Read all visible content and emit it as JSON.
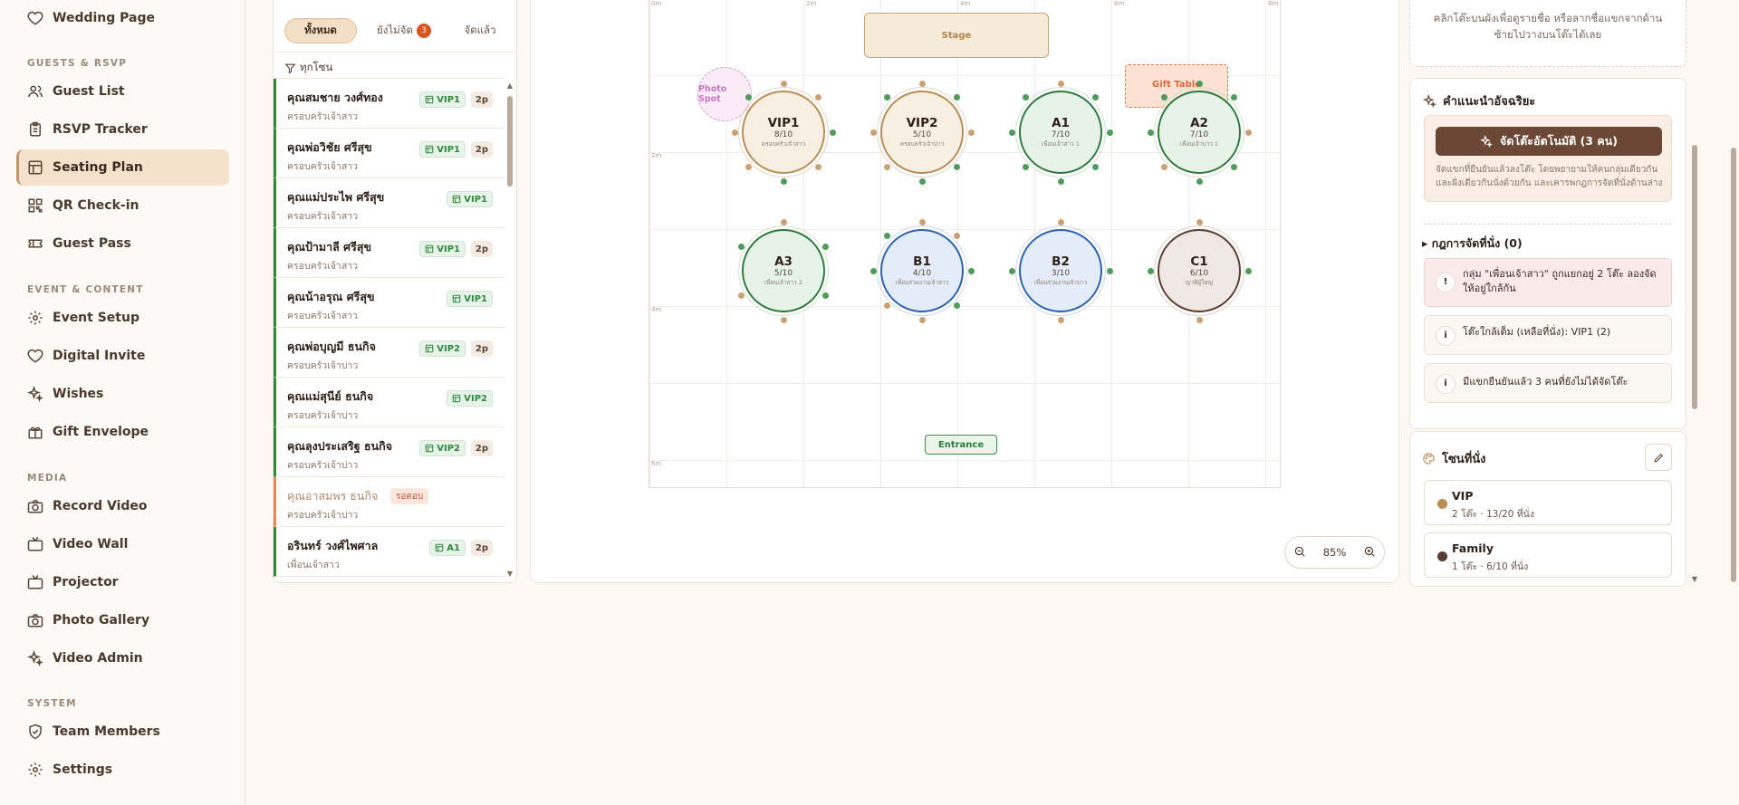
{
  "sidebar": {
    "items_top": [
      {
        "label": "Wedding Page",
        "icon": "heart-icon"
      }
    ],
    "sections": [
      {
        "title": "GUESTS & RSVP",
        "items": [
          {
            "label": "Guest List",
            "icon": "users-icon"
          },
          {
            "label": "RSVP Tracker",
            "icon": "clipboard-icon"
          },
          {
            "label": "Seating Plan",
            "icon": "layout-icon",
            "active": true
          },
          {
            "label": "QR Check-in",
            "icon": "qr-icon"
          },
          {
            "label": "Guest Pass",
            "icon": "ticket-icon"
          }
        ]
      },
      {
        "title": "EVENT & CONTENT",
        "items": [
          {
            "label": "Event Setup",
            "icon": "gear-icon"
          },
          {
            "label": "Digital Invite",
            "icon": "heart-icon"
          },
          {
            "label": "Wishes",
            "icon": "sparkle-icon"
          },
          {
            "label": "Gift Envelope",
            "icon": "gift-icon"
          }
        ]
      },
      {
        "title": "MEDIA",
        "items": [
          {
            "label": "Record Video",
            "icon": "camera-icon"
          },
          {
            "label": "Video Wall",
            "icon": "tv-icon"
          },
          {
            "label": "Projector",
            "icon": "tv-icon"
          },
          {
            "label": "Photo Gallery",
            "icon": "camera-icon"
          },
          {
            "label": "Video Admin",
            "icon": "sparkle-icon"
          }
        ]
      },
      {
        "title": "SYSTEM",
        "items": [
          {
            "label": "Team Members",
            "icon": "shield-icon"
          },
          {
            "label": "Settings",
            "icon": "gear-icon"
          }
        ]
      }
    ]
  },
  "guest_panel": {
    "tabs": [
      {
        "label": "ทั้งหมด",
        "active": true
      },
      {
        "label": "ยังไม่จัด",
        "badge": "3"
      },
      {
        "label": "จัดแล้ว"
      }
    ],
    "filter_label": "ทุกโซน",
    "guests": [
      {
        "name": "คุณสมชาย วงศ์ทอง",
        "group": "ครอบครัวเจ้าสาว",
        "table": "VIP1",
        "count": "2p"
      },
      {
        "name": "คุณพ่อวิชัย ศรีสุข",
        "group": "ครอบครัวเจ้าสาว",
        "table": "VIP1",
        "count": "2p"
      },
      {
        "name": "คุณแม่ประไพ ศรีสุข",
        "group": "ครอบครัวเจ้าสาว",
        "table": "VIP1",
        "count": ""
      },
      {
        "name": "คุณป้ามาลี ศรีสุข",
        "group": "ครอบครัวเจ้าสาว",
        "table": "VIP1",
        "count": "2p"
      },
      {
        "name": "คุณน้าอรุณ ศรีสุข",
        "group": "ครอบครัวเจ้าสาว",
        "table": "VIP1",
        "count": ""
      },
      {
        "name": "คุณพ่อบุญมี ธนกิจ",
        "group": "ครอบครัวเจ้าบ่าว",
        "table": "VIP2",
        "count": "2p"
      },
      {
        "name": "คุณแม่สุนีย์ ธนกิจ",
        "group": "ครอบครัวเจ้าบ่าว",
        "table": "VIP2",
        "count": ""
      },
      {
        "name": "คุณลุงประเสริฐ ธนกิจ",
        "group": "ครอบครัวเจ้าบ่าว",
        "table": "VIP2",
        "count": "2p"
      },
      {
        "name": "คุณอาสมพร ธนกิจ",
        "group": "ครอบครัวเจ้าบ่าว",
        "pending": "รอตอบ"
      },
      {
        "name": "อรินทร์ วงศ์ไพศาล",
        "group": "เพื่อนเจ้าสาว",
        "table": "A1",
        "count": "2p"
      }
    ]
  },
  "canvas": {
    "rulers": [
      "0m",
      "2m",
      "4m",
      "6m",
      "8m",
      "2m",
      "4m",
      "6m"
    ],
    "zones": {
      "stage": "Stage",
      "gift": "Gift Table",
      "photo": "Photo Spot",
      "entrance": "Entrance"
    },
    "tables": [
      {
        "name": "VIP1",
        "count": "8/10",
        "group": "ครอบครัวเจ้าสาว",
        "style": "vip"
      },
      {
        "name": "VIP2",
        "count": "5/10",
        "group": "ครอบครัวเจ้าบ่าว",
        "style": "vip"
      },
      {
        "name": "A1",
        "count": "7/10",
        "group": "เพื่อนเจ้าสาว 1",
        "style": "grn"
      },
      {
        "name": "A2",
        "count": "7/10",
        "group": "เพื่อนเจ้าบ่าว 1",
        "style": "grn"
      },
      {
        "name": "A3",
        "count": "5/10",
        "group": "เพื่อนเจ้าสาว 2",
        "style": "grn"
      },
      {
        "name": "B1",
        "count": "4/10",
        "group": "เพื่อนร่วมงานเจ้าสาว",
        "style": "blu"
      },
      {
        "name": "B2",
        "count": "3/10",
        "group": "เพื่อนร่วมงานเจ้าบ่าว",
        "style": "blu"
      },
      {
        "name": "C1",
        "count": "6/10",
        "group": "ญาติผู้ใหญ่",
        "style": "brn"
      }
    ],
    "zoom": "85%"
  },
  "right_panel": {
    "hint": "คลิกโต๊ะบนผังเพื่อดูรายชื่อ หรือลากชื่อแขกจากด้านซ้ายไปวางบนโต๊ะได้เลย",
    "suggest_title": "คำแนะนำอัจฉริยะ",
    "auto_button": "จัดโต๊ะอัตโนมัติ (3 คน)",
    "auto_desc": "จัดแขกที่ยืนยันแล้วลงโต๊ะ โดยพยายามให้คนกลุ่มเดียวกันและฝั่งเดียวกันนั่งด้วยกัน และเคารพกฎการจัดที่นั่งด้านล่าง",
    "rules_title": "กฎการจัดที่นั่ง (0)",
    "rules": [
      {
        "type": "warn",
        "icon": "!",
        "text": "กลุ่ม \"เพื่อนเจ้าสาว\" ถูกแยกอยู่ 2 โต๊ะ ลองจัดให้อยู่ใกล้กัน"
      },
      {
        "type": "info",
        "icon": "i",
        "text": "โต๊ะใกล้เต็ม (เหลือที่นั่ง): VIP1 (2)"
      },
      {
        "type": "info",
        "icon": "i",
        "text": "มีแขกยืนยันแล้ว 3 คนที่ยังไม่ได้จัดโต๊ะ"
      }
    ],
    "zones_title": "โซนที่นั่ง",
    "zones": [
      {
        "name": "VIP",
        "summary": "2 โต๊ะ · 13/20 ที่นั่ง",
        "color": "#b98d56"
      },
      {
        "name": "Family",
        "summary": "1 โต๊ะ · 6/10 ที่นั่ง",
        "color": "#5a3e2e"
      }
    ]
  }
}
